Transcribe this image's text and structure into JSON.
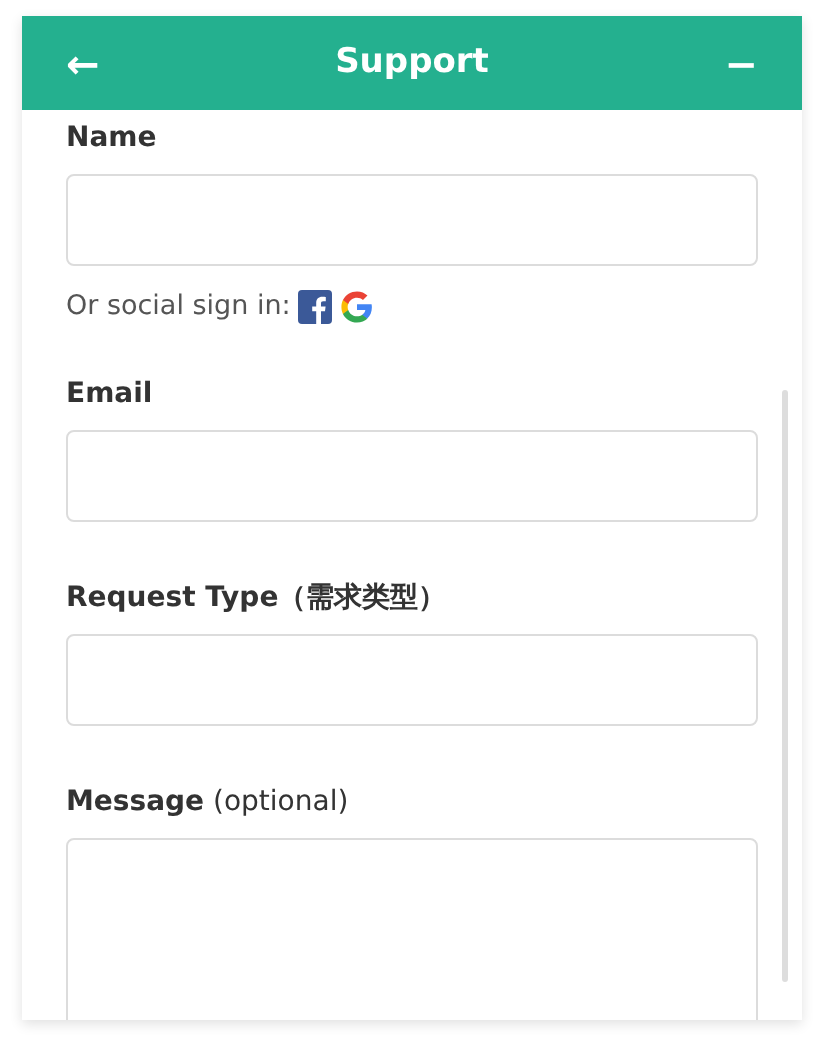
{
  "header": {
    "back": "←",
    "title": "Support",
    "minimize": "−"
  },
  "fields": [
    {
      "kind": "text",
      "label": "Name"
    },
    {
      "kind": "social",
      "label": "Or social sign in:"
    },
    {
      "kind": "text",
      "label": "Email"
    },
    {
      "kind": "select",
      "label": "Request Type（需求类型）"
    },
    {
      "kind": "textarea",
      "label": "**Message** (optional)"
    }
  ]
}
